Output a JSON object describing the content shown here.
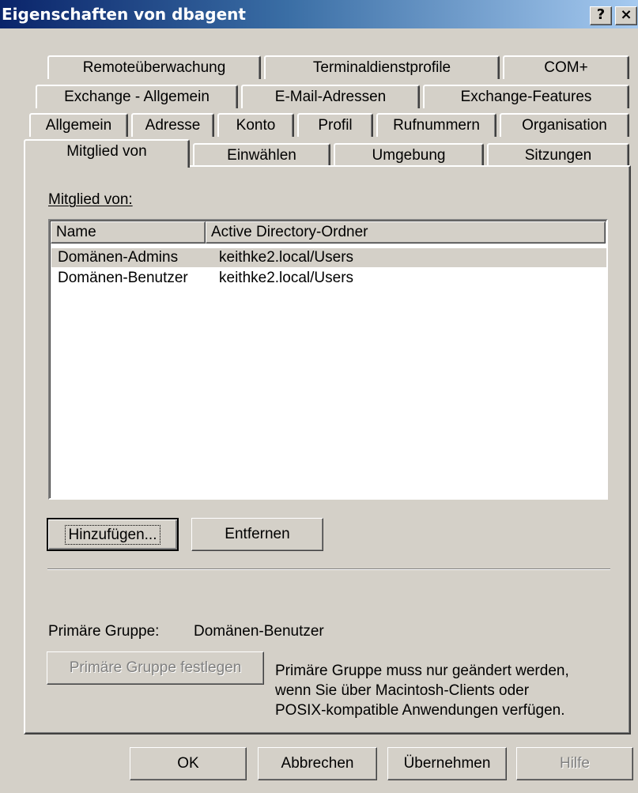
{
  "window": {
    "title": "Eigenschaften von dbagent",
    "help_button": "?",
    "close_button": "×"
  },
  "tabs": {
    "row1": [
      "Remoteüberwachung",
      "Terminaldienstprofile",
      "COM+"
    ],
    "row2": [
      "Exchange - Allgemein",
      "E-Mail-Adressen",
      "Exchange-Features"
    ],
    "row3": [
      "Allgemein",
      "Adresse",
      "Konto",
      "Profil",
      "Rufnummern",
      "Organisation"
    ],
    "row4": [
      "Mitglied von",
      "Einwählen",
      "Umgebung",
      "Sitzungen"
    ],
    "active": "Mitglied von"
  },
  "member_of": {
    "label": "Mitglied von:",
    "columns": [
      "Name",
      "Active Directory-Ordner"
    ],
    "rows": [
      {
        "name": "Domänen-Admins",
        "folder": "keithke2.local/Users"
      },
      {
        "name": "Domänen-Benutzer",
        "folder": "keithke2.local/Users"
      }
    ]
  },
  "buttons": {
    "add": "Hinzufügen...",
    "remove": "Entfernen",
    "set_primary": "Primäre Gruppe festlegen",
    "ok": "OK",
    "cancel": "Abbrechen",
    "apply": "Übernehmen",
    "help": "Hilfe"
  },
  "primary_group": {
    "label": "Primäre Gruppe:",
    "value": "Domänen-Benutzer",
    "help_lines": [
      "Primäre Gruppe muss nur geändert werden,",
      "wenn Sie über Macintosh-Clients oder",
      "POSIX-kompatible Anwendungen verfügen."
    ]
  },
  "colors": {
    "title_active": "#0a246a",
    "title_gradient_end": "#a6caf0",
    "face": "#d4d0c8",
    "disabled_text": "#808080"
  }
}
